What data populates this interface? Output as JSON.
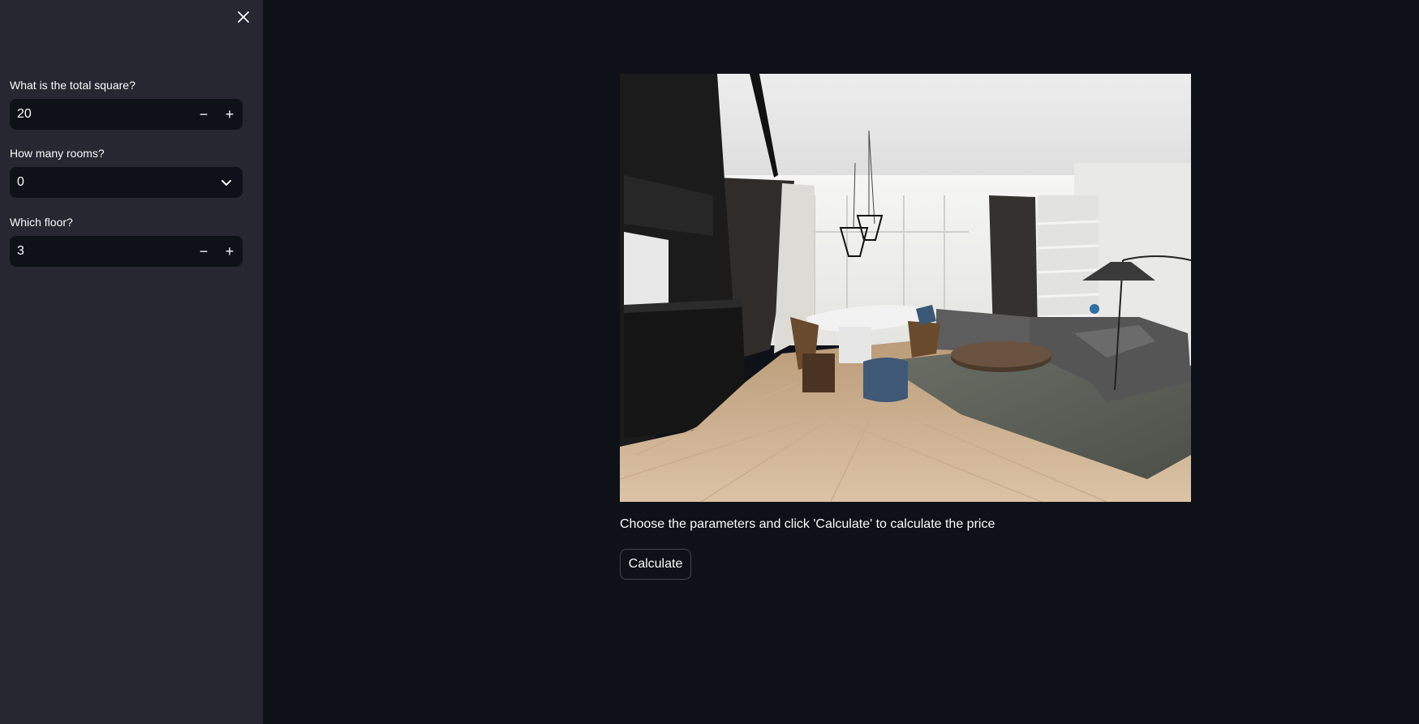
{
  "sidebar": {
    "close_icon": "close-icon",
    "fields": [
      {
        "label": "What is the total square?",
        "value": "20",
        "type": "number"
      },
      {
        "label": "How many rooms?",
        "value": "0",
        "type": "select"
      },
      {
        "label": "Which floor?",
        "value": "3",
        "type": "number"
      }
    ],
    "stepper": {
      "minus": "−",
      "plus": "+"
    }
  },
  "main": {
    "image_alt": "Modern living room with kitchen",
    "caption": "Choose the parameters and click 'Calculate' to calculate the price",
    "button_label": "Calculate"
  },
  "colors": {
    "sidebar_bg": "#262730",
    "main_bg": "#0e1117",
    "text": "#fafafa"
  }
}
